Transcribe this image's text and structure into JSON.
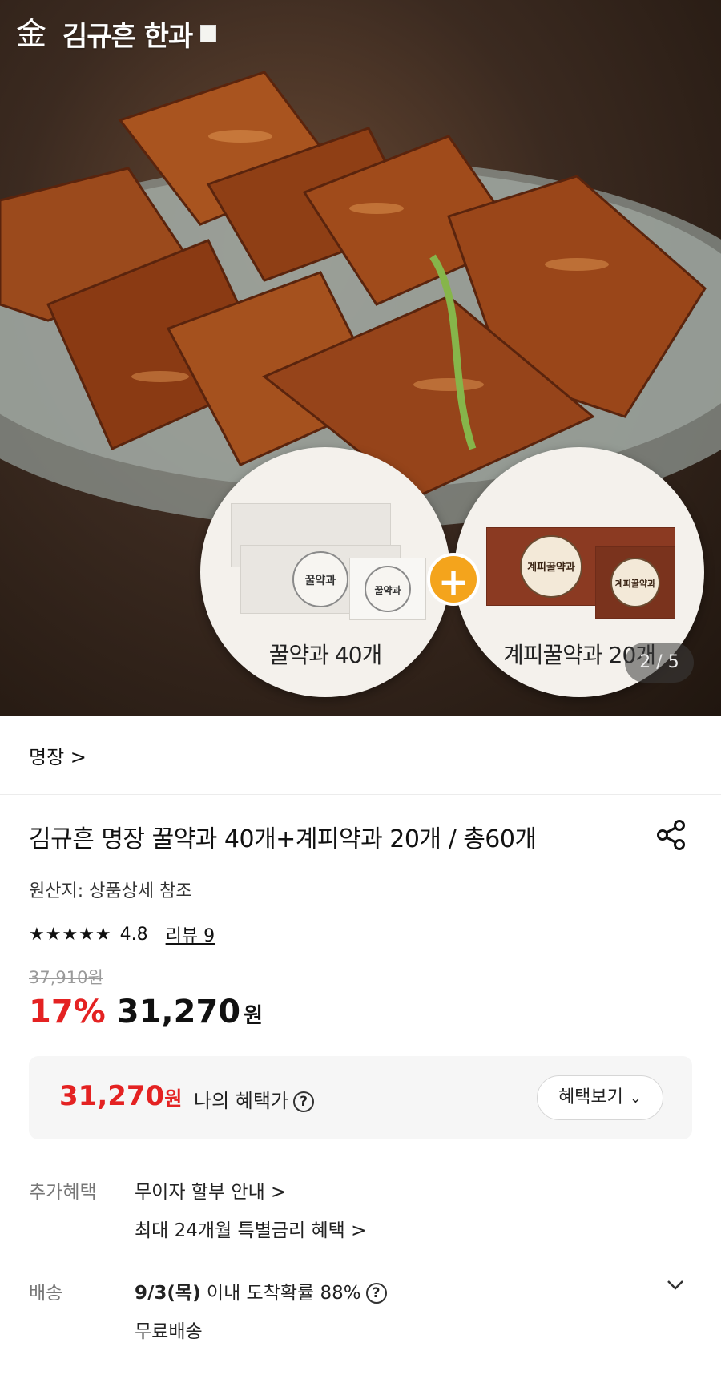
{
  "hero": {
    "brand_mark": "金",
    "brand_name": "김규흔 한과",
    "left_product": "꿀약과 40개",
    "right_product": "계피꿀약과 20개",
    "box_label_left": "꿀약과",
    "box_label_right": "계피꿀약과",
    "plus": "+",
    "pager": "2 / 5"
  },
  "product": {
    "brand_link": "명장 >",
    "title": "김규흔 명장 꿀약과 40개+계피약과 20개 / 총60개",
    "origin": "원산지: 상품상세 참조",
    "stars": "★★★★★",
    "rating": "4.8",
    "review": "리뷰 9",
    "original_price": "37,910원",
    "discount": "17%",
    "price": "31,270",
    "price_unit": "원"
  },
  "benefit": {
    "price": "31,270",
    "price_unit": "원",
    "label": "나의 혜택가",
    "help": "?",
    "button": "혜택보기"
  },
  "extra": {
    "label": "추가혜택",
    "line1": "무이자 할부 안내 >",
    "line2": "최대 24개월 특별금리 혜택 >"
  },
  "delivery": {
    "label": "배송",
    "date": "9/3(목)",
    "text": " 이내 도착확률 88%",
    "help": "?",
    "fee": "무료배송"
  },
  "colors": {
    "accent_red": "#e42222",
    "plus_orange": "#f4a41c"
  }
}
